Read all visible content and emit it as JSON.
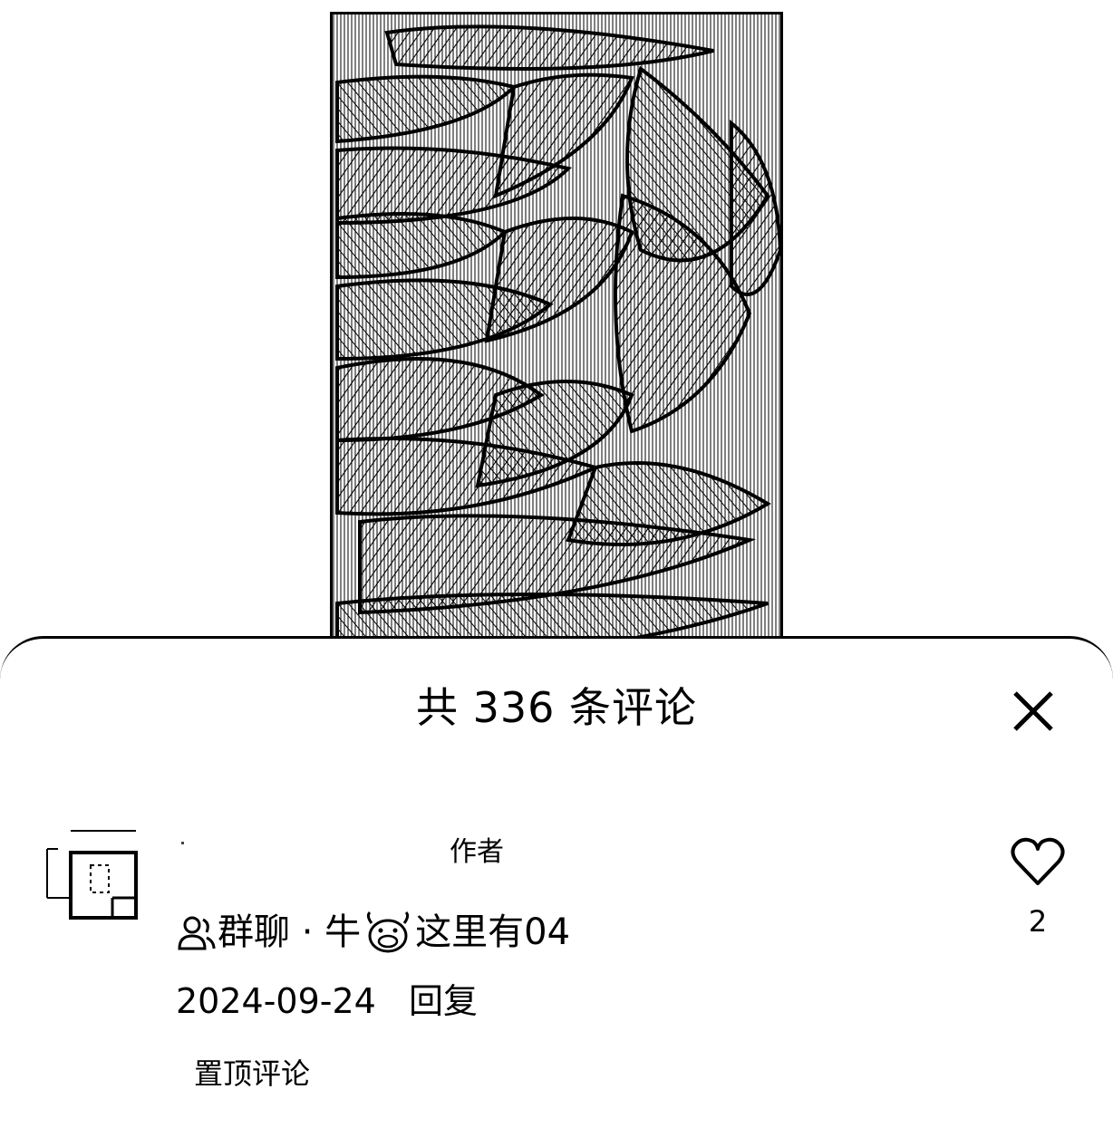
{
  "photo": {
    "alt_icon": "leaf-photo"
  },
  "comments_sheet": {
    "title": "共 336 条评论",
    "close_icon": "close-icon"
  },
  "comment": {
    "author_tag": "作者",
    "text_before_icon": "群聊 · 牛",
    "text_after_icon": "这里有04",
    "date": "2024-09-24",
    "reply_label": "回复",
    "pinned_label": "置顶评论",
    "like_count": "2"
  }
}
